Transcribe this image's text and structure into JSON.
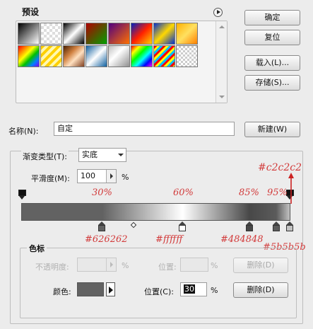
{
  "presets": {
    "title": "预设",
    "swatches": [
      "linear-gradient(135deg,#000 0%,#fff 100%)",
      "repeating-conic-gradient(#ddd 0% 25%,#fff 0% 50%) 0 0/8px 8px",
      "linear-gradient(135deg,#000 0%,#fff 50%,#000 100%)",
      "linear-gradient(135deg,#b00000 0%,#00a000 100%)",
      "linear-gradient(135deg,#500080 0%,#ff7000 100%)",
      "linear-gradient(135deg,#0020c0 0%,#ff2000 50%,#ffd000 100%)",
      "linear-gradient(135deg,#0030d0 0%,#ffd800 50%,#0030d0 100%)",
      "linear-gradient(135deg,#ffb000 0%,#ffe060 50%,#ff8000 100%)",
      "linear-gradient(135deg,#ff0000,#ff8000,#ffff00,#00c000,#0080ff,#8000ff)",
      "repeating-linear-gradient(135deg,#ffd000 0 4px,#fff8b0 4px 8px)",
      "linear-gradient(135deg,#4a2000 0%,#d08040 35%,#ffe0c0 60%,#804020 100%)",
      "linear-gradient(135deg,#1060a0 0%,#fff 50%,#1060a0 100%)",
      "linear-gradient(135deg,#c0c0c0 0%,#fff 40%,#909090 100%)",
      "linear-gradient(135deg,#ff0000,#ffff00,#00ff00,#00ffff,#0000ff,#ff00ff)",
      "repeating-linear-gradient(135deg,#ff0000 0 3px,#ffff00 3px 6px,#00c0ff 6px 9px)",
      "repeating-conic-gradient(#ccc 0% 25%,#fff 0% 50%) 0 0/6px 6px"
    ]
  },
  "buttons": {
    "ok": "确定",
    "reset": "复位",
    "load": "载入(L)...",
    "save": "存储(S)...",
    "new": "新建(W)"
  },
  "name": {
    "label": "名称(N):",
    "value": "自定"
  },
  "gradient_type": {
    "label": "渐变类型(T):",
    "value": "实底"
  },
  "smoothness": {
    "label": "平滑度(M):",
    "value": "100",
    "unit": "%"
  },
  "color_stops_section": {
    "title": "色标",
    "opacity_label": "不透明度:",
    "opacity_unit": "%",
    "opacity_position_label": "位置:",
    "opacity_position_unit": "%",
    "opacity_delete": "删除(D)",
    "color_label": "颜色:",
    "color_value": "#626262",
    "position_label": "位置(C):",
    "position_value": "30",
    "position_unit": "%",
    "delete": "删除(D)"
  },
  "gradient": {
    "stops": [
      {
        "color": "#626262",
        "position": 0
      },
      {
        "color": "#626262",
        "position": 30
      },
      {
        "color": "#ffffff",
        "position": 60
      },
      {
        "color": "#484848",
        "position": 85
      },
      {
        "color": "#5b5b5b",
        "position": 95
      },
      {
        "color": "#c2c2c2",
        "position": 100
      }
    ]
  },
  "annotations": {
    "p30": "30%",
    "p60": "60%",
    "p85": "85%",
    "p95": "95%",
    "c626262": "#626262",
    "cffffff": "#ffffff",
    "c484848": "#484848",
    "c5b5b5b": "#5b5b5b",
    "cc2c2c2": "#c2c2c2"
  },
  "colors": {
    "annotation": "#d23a3a",
    "accent_arrow": "#cc2222"
  }
}
